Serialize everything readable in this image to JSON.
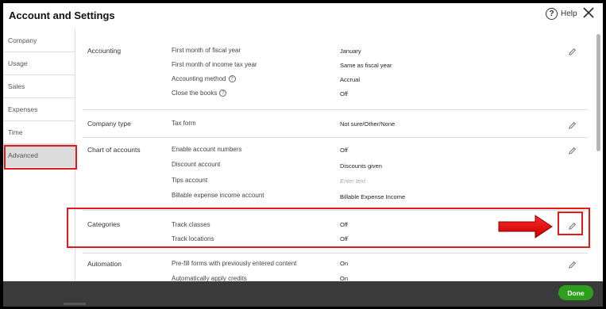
{
  "header": {
    "title": "Account and Settings",
    "help_icon": "?",
    "help_label": "Help"
  },
  "sidebar": {
    "items": [
      {
        "label": "Company"
      },
      {
        "label": "Usage"
      },
      {
        "label": "Sales"
      },
      {
        "label": "Expenses"
      },
      {
        "label": "Time"
      },
      {
        "label": "Advanced"
      }
    ],
    "active": "Advanced"
  },
  "sections": {
    "accounting": {
      "label": "Accounting",
      "rows": [
        {
          "label": "First month of fiscal year",
          "value": "January"
        },
        {
          "label": "First month of income tax year",
          "value": "Same as fiscal year"
        },
        {
          "label": "Accounting method",
          "value": "Accrual"
        },
        {
          "label": "Close the books",
          "value": "Off"
        }
      ]
    },
    "company_type": {
      "label": "Company type",
      "rows": [
        {
          "label": "Tax form",
          "value": "Not sure/Other/None"
        }
      ]
    },
    "chart_of_accounts": {
      "label": "Chart of accounts",
      "rows": [
        {
          "label": "Enable account numbers",
          "value": "Off"
        },
        {
          "label": "Discount account",
          "value": "Discounts given"
        },
        {
          "label": "Tips account",
          "value": "Enter text"
        },
        {
          "label": "Billable expense income account",
          "value": "Billable Expense Income"
        }
      ]
    },
    "categories": {
      "label": "Categories",
      "rows": [
        {
          "label": "Track classes",
          "value": "Off"
        },
        {
          "label": "Track locations",
          "value": "Off"
        }
      ]
    },
    "automation": {
      "label": "Automation",
      "rows": [
        {
          "label": "Pre-fill forms with previously entered content",
          "value": "On"
        },
        {
          "label": "Automatically apply credits",
          "value": "On"
        }
      ]
    }
  },
  "info_icon_glyph": "?",
  "footer": {
    "done_label": "Done"
  },
  "colors": {
    "highlight": "#e41b1b",
    "done_button": "#2ca01c",
    "footer_bg": "#3a3a3a",
    "active_sidebar": "#dcdcdc"
  }
}
